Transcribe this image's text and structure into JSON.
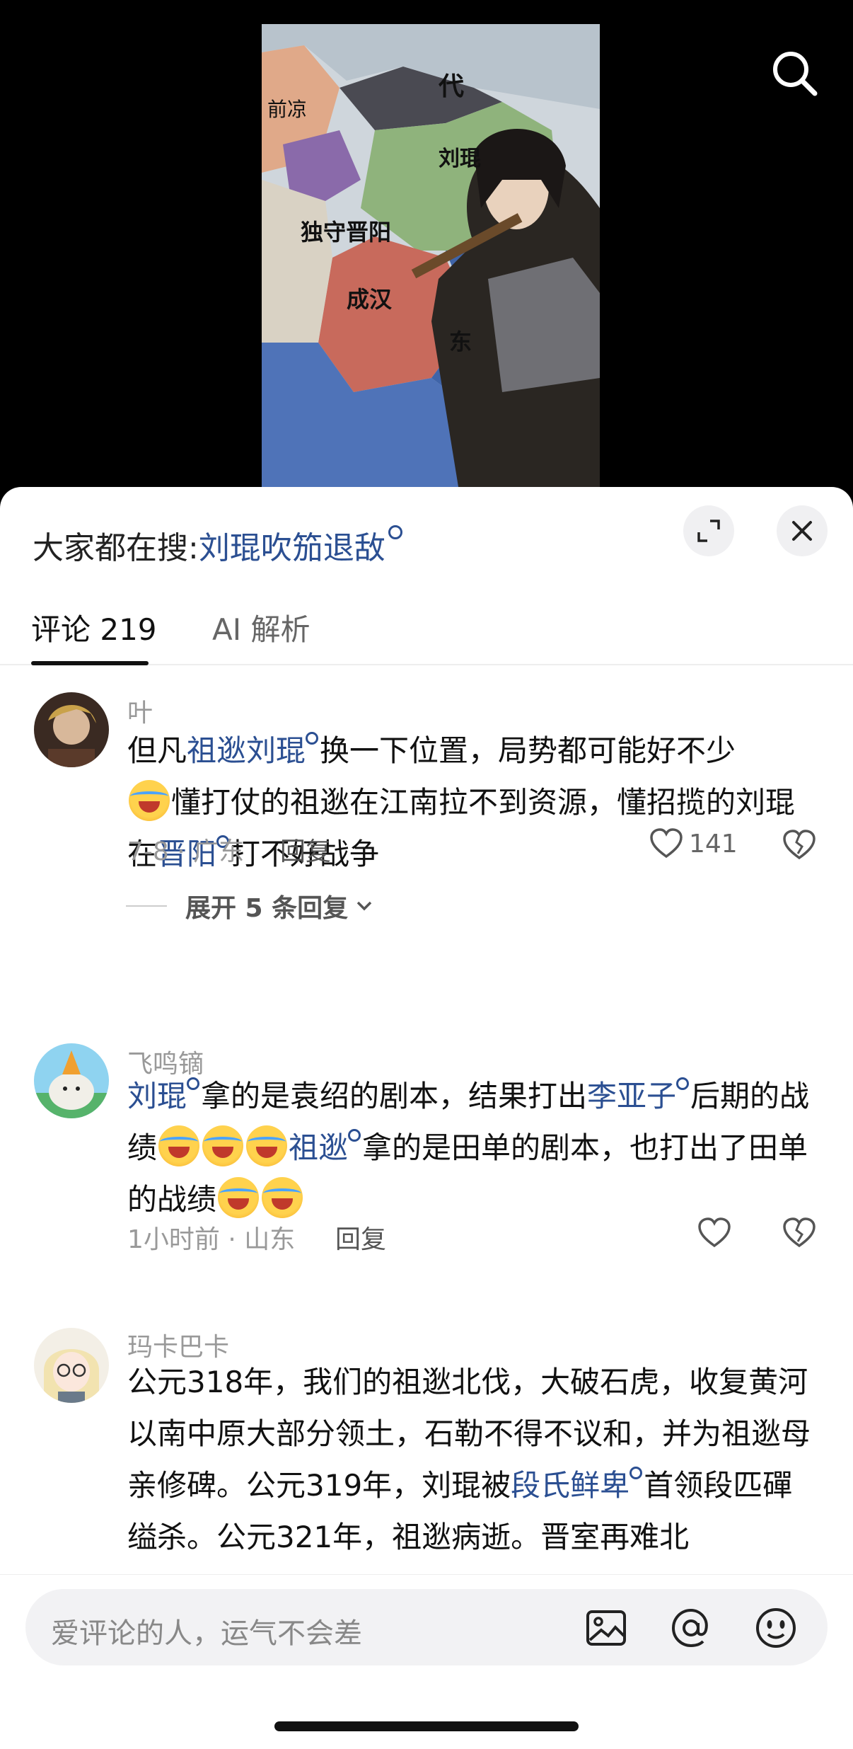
{
  "video": {
    "map_labels": [
      "代",
      "前凉",
      "刘琨",
      "独守晋阳",
      "成汉",
      "东"
    ],
    "search_icon": "search-icon"
  },
  "sheet": {
    "hot_search_prefix": "大家都在搜:",
    "hot_search_keyword": "刘琨吹笳退敌",
    "expand_icon": "expand-icon",
    "close_icon": "close-icon",
    "tabs": [
      {
        "label": "评论 219",
        "active": true
      },
      {
        "label": "AI 解析",
        "active": false
      }
    ]
  },
  "comments": [
    {
      "user": "叶",
      "text_parts": [
        "但凡",
        "祖逖刘琨",
        "换一下位置，局势都可能好不少",
        "懂打仗的祖逖在江南拉不到资源，懂招揽的刘琨在",
        "晋阳",
        "打不好战争"
      ],
      "meta": "7-8 · 广东",
      "reply_label": "回复",
      "likes": "141",
      "expand_label": "展开 5 条回复"
    },
    {
      "user": "飞鸣镝",
      "text_parts": [
        "刘琨",
        "拿的是袁绍的剧本，结果打出",
        "李亚子",
        "后期的战绩",
        "祖逖",
        "拿的是田单的剧本，也打出了田单的战绩"
      ],
      "meta": "1小时前 · 山东",
      "reply_label": "回复"
    },
    {
      "user": "玛卡巴卡",
      "text_parts": [
        "公元318年，我们的祖逖北伐，大破石虎，收复黄河以南中原大部分领土，石勒不得不议和，并为祖逖母亲修碑。公元319年，刘琨被",
        "段氏鲜卑",
        "首领段匹磾缢杀。公元321年，祖逖病逝。晋室再难北"
      ]
    }
  ],
  "input": {
    "placeholder": "爱评论的人，运气不会差",
    "icons": [
      "image-icon",
      "at-icon",
      "emoji-icon"
    ]
  },
  "colors": {
    "keyword": "#2b4f92",
    "muted": "#999999"
  }
}
